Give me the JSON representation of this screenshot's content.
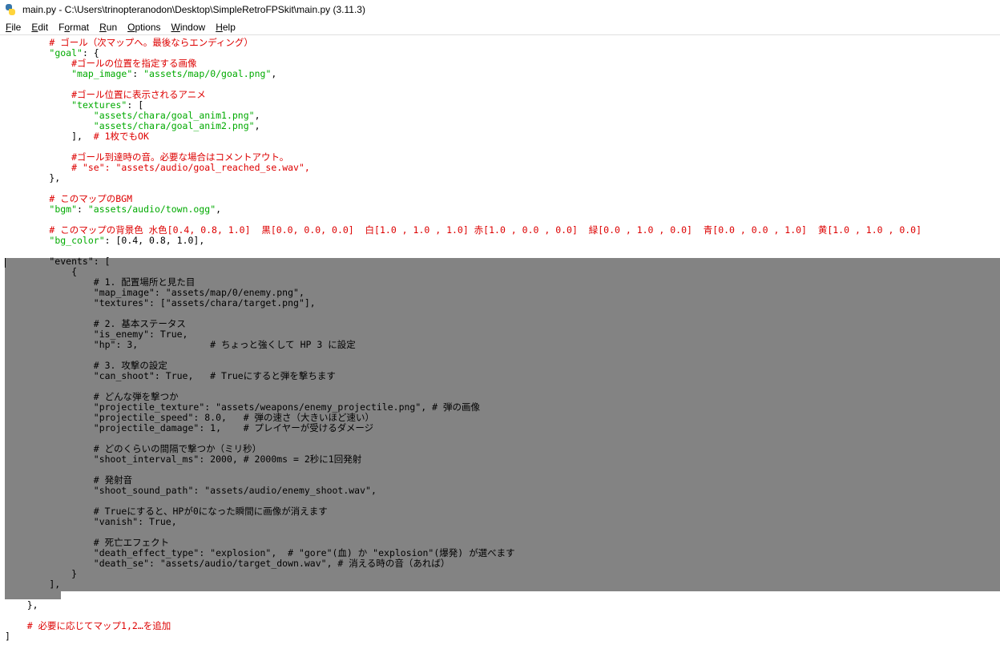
{
  "window": {
    "title": "main.py - C:\\Users\\trinopteranodon\\Desktop\\SimpleRetroFPSkit\\main.py (3.11.3)",
    "icon": "python-file-icon"
  },
  "menu": [
    {
      "key": "F",
      "rest": "ile"
    },
    {
      "key": "E",
      "rest": "dit"
    },
    {
      "key": "",
      "pre": "F",
      "rest": "ormat",
      "ukey": "o"
    },
    {
      "key": "R",
      "rest": "un"
    },
    {
      "key": "O",
      "rest": "ptions"
    },
    {
      "key": "W",
      "rest": "indow"
    },
    {
      "key": "H",
      "rest": "elp"
    }
  ],
  "menu_labels": [
    "File",
    "Edit",
    "Format",
    "Run",
    "Options",
    "Window",
    "Help"
  ],
  "colors": {
    "comment": "#dd0000",
    "string": "#00aa00",
    "selection": "#838383"
  },
  "selection": {
    "first_line": 21,
    "last_line": 52
  },
  "code_lines": [
    [
      [
        "c",
        "        # ゴール（次マップへ。最後ならエンディング）"
      ]
    ],
    [
      [
        "p",
        "        "
      ],
      [
        "s",
        "\"goal\""
      ],
      [
        "p",
        ": {"
      ]
    ],
    [
      [
        "p",
        "            "
      ],
      [
        "c",
        "#ゴールの位置を指定する画像"
      ]
    ],
    [
      [
        "p",
        "            "
      ],
      [
        "s",
        "\"map_image\""
      ],
      [
        "p",
        ": "
      ],
      [
        "s",
        "\"assets/map/0/goal.png\""
      ],
      [
        "p",
        ","
      ]
    ],
    [
      [
        "p",
        ""
      ]
    ],
    [
      [
        "p",
        "            "
      ],
      [
        "c",
        "#ゴール位置に表示されるアニメ"
      ]
    ],
    [
      [
        "p",
        "            "
      ],
      [
        "s",
        "\"textures\""
      ],
      [
        "p",
        ": ["
      ]
    ],
    [
      [
        "p",
        "                "
      ],
      [
        "s",
        "\"assets/chara/goal_anim1.png\""
      ],
      [
        "p",
        ","
      ]
    ],
    [
      [
        "p",
        "                "
      ],
      [
        "s",
        "\"assets/chara/goal_anim2.png\""
      ],
      [
        "p",
        ","
      ]
    ],
    [
      [
        "p",
        "            ],  "
      ],
      [
        "c",
        "# 1枚でもOK"
      ]
    ],
    [
      [
        "p",
        ""
      ]
    ],
    [
      [
        "p",
        "            "
      ],
      [
        "c",
        "#ゴール到達時の音。必要な場合はコメントアウト。"
      ]
    ],
    [
      [
        "p",
        "            "
      ],
      [
        "c",
        "# \"se\": \"assets/audio/goal_reached_se.wav\","
      ]
    ],
    [
      [
        "p",
        "        },"
      ]
    ],
    [
      [
        "p",
        ""
      ]
    ],
    [
      [
        "p",
        "        "
      ],
      [
        "c",
        "# このマップのBGM"
      ]
    ],
    [
      [
        "p",
        "        "
      ],
      [
        "s",
        "\"bgm\""
      ],
      [
        "p",
        ": "
      ],
      [
        "s",
        "\"assets/audio/town.ogg\""
      ],
      [
        "p",
        ","
      ]
    ],
    [
      [
        "p",
        ""
      ]
    ],
    [
      [
        "p",
        "        "
      ],
      [
        "c",
        "# このマップの背景色 水色[0.4, 0.8, 1.0]  黒[0.0, 0.0, 0.0]  白[1.0 , 1.0 , 1.0] 赤[1.0 , 0.0 , 0.0]  緑[0.0 , 1.0 , 0.0]  青[0.0 , 0.0 , 1.0]  黄[1.0 , 1.0 , 0.0]"
      ]
    ],
    [
      [
        "p",
        "        "
      ],
      [
        "s",
        "\"bg_color\""
      ],
      [
        "p",
        ": [0.4, 0.8, 1.0],"
      ]
    ],
    [
      [
        "p",
        ""
      ]
    ],
    [
      [
        "p",
        "        \"events\": ["
      ]
    ],
    [
      [
        "p",
        "            {"
      ]
    ],
    [
      [
        "p",
        "                # 1. 配置場所と見た目"
      ]
    ],
    [
      [
        "p",
        "                \"map_image\": \"assets/map/0/enemy.png\","
      ]
    ],
    [
      [
        "p",
        "                \"textures\": [\"assets/chara/target.png\"],"
      ]
    ],
    [
      [
        "p",
        ""
      ]
    ],
    [
      [
        "p",
        "                # 2. 基本ステータス"
      ]
    ],
    [
      [
        "p",
        "                \"is_enemy\": True,"
      ]
    ],
    [
      [
        "p",
        "                \"hp\": 3,             # ちょっと強くして HP 3 に設定"
      ]
    ],
    [
      [
        "p",
        ""
      ]
    ],
    [
      [
        "p",
        "                # 3. 攻撃の設定"
      ]
    ],
    [
      [
        "p",
        "                \"can_shoot\": True,   # Trueにすると弾を撃ちます"
      ]
    ],
    [
      [
        "p",
        ""
      ]
    ],
    [
      [
        "p",
        "                # どんな弾を撃つか"
      ]
    ],
    [
      [
        "p",
        "                \"projectile_texture\": \"assets/weapons/enemy_projectile.png\", # 弾の画像"
      ]
    ],
    [
      [
        "p",
        "                \"projectile_speed\": 8.0,   # 弾の速さ（大きいほど速い）"
      ]
    ],
    [
      [
        "p",
        "                \"projectile_damage\": 1,    # プレイヤーが受けるダメージ"
      ]
    ],
    [
      [
        "p",
        ""
      ]
    ],
    [
      [
        "p",
        "                # どのくらいの間隔で撃つか（ミリ秒）"
      ]
    ],
    [
      [
        "p",
        "                \"shoot_interval_ms\": 2000, # 2000ms = 2秒に1回発射"
      ]
    ],
    [
      [
        "p",
        ""
      ]
    ],
    [
      [
        "p",
        "                # 発射音"
      ]
    ],
    [
      [
        "p",
        "                \"shoot_sound_path\": \"assets/audio/enemy_shoot.wav\","
      ]
    ],
    [
      [
        "p",
        ""
      ]
    ],
    [
      [
        "p",
        "                # Trueにすると、HPが0になった瞬間に画像が消えます"
      ]
    ],
    [
      [
        "p",
        "                \"vanish\": True,"
      ]
    ],
    [
      [
        "p",
        ""
      ]
    ],
    [
      [
        "p",
        "                # 死亡エフェクト"
      ]
    ],
    [
      [
        "p",
        "                \"death_effect_type\": \"explosion\",  # \"gore\"(血) か \"explosion\"(爆発) が選べます"
      ]
    ],
    [
      [
        "p",
        "                \"death_se\": \"assets/audio/target_down.wav\", # 消える時の音（あれば）"
      ]
    ],
    [
      [
        "p",
        "            }"
      ]
    ],
    [
      [
        "p",
        "        ],"
      ]
    ],
    [
      [
        "p",
        ""
      ]
    ],
    [
      [
        "p",
        "    },"
      ]
    ],
    [
      [
        "p",
        ""
      ]
    ],
    [
      [
        "p",
        "    "
      ],
      [
        "c",
        "# 必要に応じてマップ1,2…を追加"
      ]
    ],
    [
      [
        "p",
        "]"
      ]
    ]
  ]
}
